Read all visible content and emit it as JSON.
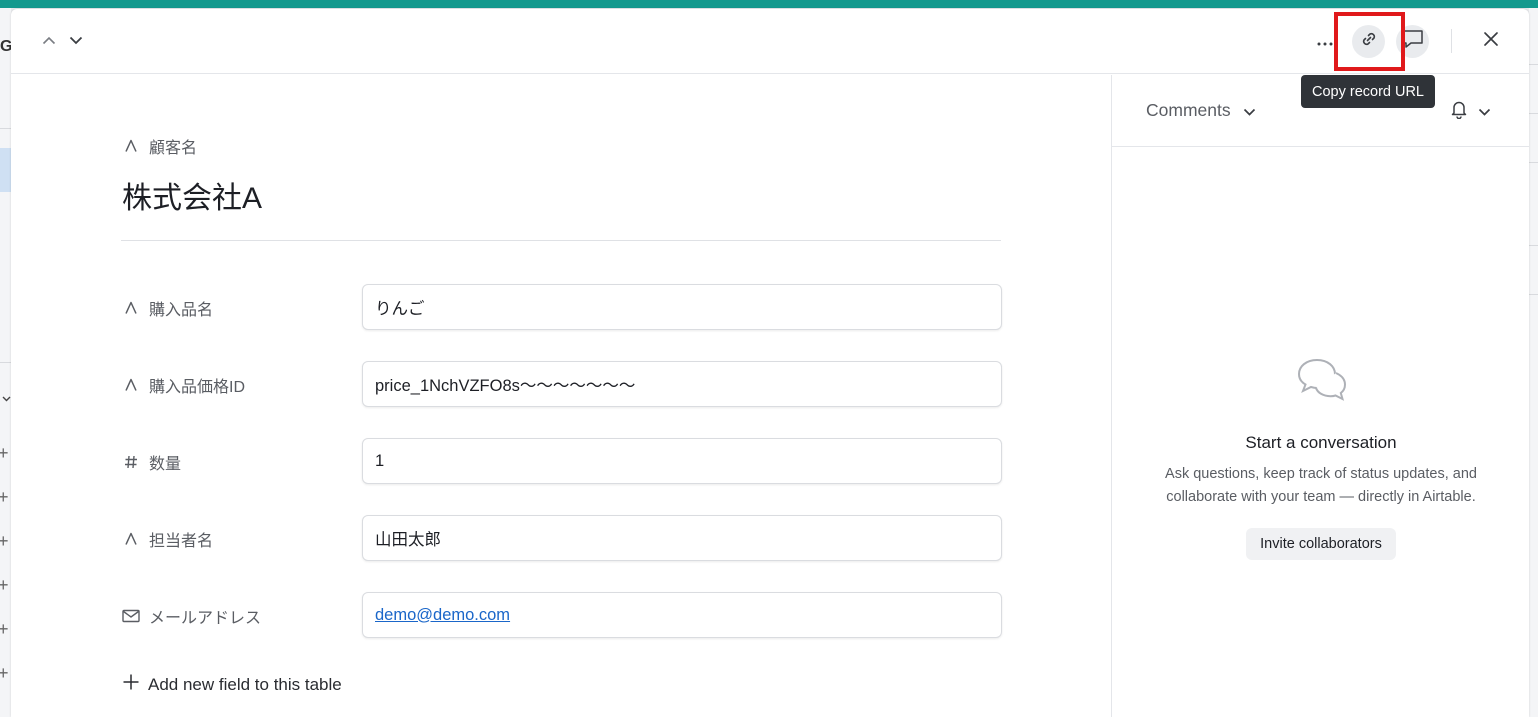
{
  "background": {
    "left_letter": "G",
    "accent_color": "#14998e"
  },
  "header": {
    "more_icon": "ellipsis-icon",
    "copy_link_icon": "link-icon",
    "comment_toggle_icon": "comment-icon",
    "close_icon": "close-icon"
  },
  "tooltip": {
    "text": "Copy record URL"
  },
  "record": {
    "primary_field_label": "顧客名",
    "primary_value": "株式会社A",
    "fields": [
      {
        "label": "購入品名",
        "value": "りんご",
        "type": "text"
      },
      {
        "label": "購入品価格ID",
        "value": "price_1NchVZFO8s〜〜〜〜〜〜〜",
        "type": "text"
      },
      {
        "label": "数量",
        "value": "1",
        "type": "number"
      },
      {
        "label": "担当者名",
        "value": "山田太郎",
        "type": "text"
      },
      {
        "label": "メールアドレス",
        "value": "demo@demo.com",
        "type": "email"
      }
    ],
    "add_field_label": "Add new field to this table"
  },
  "comments": {
    "dropdown_label": "Comments",
    "empty_title": "Start a conversation",
    "empty_description": "Ask questions, keep track of status updates, and collaborate with your team — directly in Airtable.",
    "invite_label": "Invite collaborators"
  },
  "colors": {
    "highlight": "#e0191b",
    "link": "#1a66c9"
  }
}
